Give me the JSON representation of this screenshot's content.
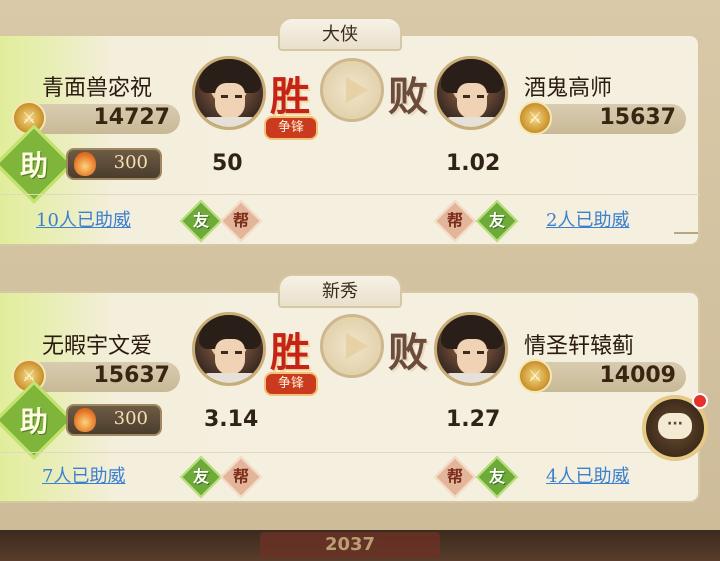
{
  "matches": [
    {
      "tab": "大侠",
      "left": {
        "name": "青面兽宓祝",
        "score": "14727",
        "odds": "50",
        "cheers": "10人已助威",
        "friend": "友",
        "gang": "帮"
      },
      "right": {
        "name": "酒鬼高师",
        "score": "15637",
        "odds": "1.02",
        "cheers": "2人已助威",
        "friend": "友",
        "gang": "帮"
      },
      "win_label": "胜",
      "lose_label": "败",
      "vs_label": "争锋",
      "assist_label": "助",
      "bet": "300"
    },
    {
      "tab": "新秀",
      "left": {
        "name": "无暇宇文爱",
        "score": "15637",
        "odds": "3.14",
        "cheers": "7人已助威",
        "friend": "友",
        "gang": "帮"
      },
      "right": {
        "name": "情圣轩辕蓟",
        "score": "14009",
        "odds": "1.27",
        "cheers": "4人已助威",
        "friend": "友",
        "gang": "帮"
      },
      "win_label": "胜",
      "lose_label": "败",
      "vs_label": "争锋",
      "assist_label": "助",
      "bet": "300"
    }
  ],
  "bottom_ghost": "2037",
  "colors": {
    "win": "#c4231a",
    "link": "#3b7fd1",
    "accent_green": "#7eb53a"
  }
}
